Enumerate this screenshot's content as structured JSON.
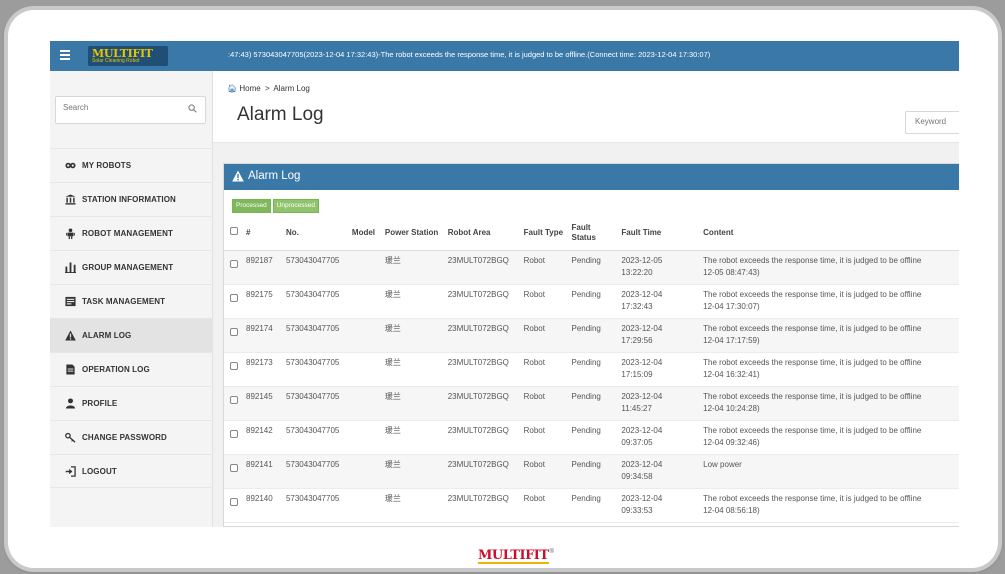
{
  "brand": {
    "logo_text": "MULTIFIT",
    "logo_subtitle": "Solar Cleaning Robot",
    "footer_logo": "MULTIFIT",
    "footer_reg": "®"
  },
  "topbar": {
    "ticker": ":47:43)    573043047705(2023-12-04 17:32:43)-The robot exceeds the response time, it is judged to be offline.(Connect time:  2023-12-04 17:30:07)"
  },
  "sidebar": {
    "search_placeholder": "Search",
    "items": [
      {
        "label": "MY ROBOTS",
        "icon": "robots-icon"
      },
      {
        "label": "STATION INFORMATION",
        "icon": "station-icon"
      },
      {
        "label": "ROBOT MANAGEMENT",
        "icon": "robot-management-icon"
      },
      {
        "label": "GROUP MANAGEMENT",
        "icon": "group-icon"
      },
      {
        "label": "TASK MANAGEMENT",
        "icon": "task-icon"
      },
      {
        "label": "ALARM LOG",
        "icon": "warning-icon",
        "active": true
      },
      {
        "label": "OPERATION LOG",
        "icon": "document-icon"
      },
      {
        "label": "PROFILE",
        "icon": "user-icon"
      },
      {
        "label": "CHANGE PASSWORD",
        "icon": "key-icon"
      },
      {
        "label": "LOGOUT",
        "icon": "logout-icon"
      }
    ]
  },
  "breadcrumb": {
    "home": "Home",
    "separator": ">",
    "current": "Alarm Log"
  },
  "page": {
    "title": "Alarm Log",
    "keyword_placeholder": "Keyword"
  },
  "panel": {
    "title": "Alarm Log",
    "filters": [
      "Processed",
      "Unprocessed"
    ]
  },
  "table": {
    "headers": {
      "id": "#",
      "no": "No.",
      "model": "Model",
      "power_station": "Power Station",
      "robot_area": "Robot Area",
      "fault_type": "Fault Type",
      "fault_status": "Fault Status",
      "fault_time": "Fault Time",
      "content": "Content"
    },
    "rows": [
      {
        "id": "892187",
        "no": "573043047705",
        "model": "",
        "station": "瑗兰",
        "area": "23MULT072BGQ",
        "type": "Robot",
        "status": "Pending",
        "date": "2023-12-05",
        "time": "13:22:20",
        "c1": "The robot exceeds the response time, it is judged to be offline",
        "c2": "12-05 08:47:43)"
      },
      {
        "id": "892175",
        "no": "573043047705",
        "model": "",
        "station": "瑗兰",
        "area": "23MULT072BGQ",
        "type": "Robot",
        "status": "Pending",
        "date": "2023-12-04",
        "time": "17:32:43",
        "c1": "The robot exceeds the response time, it is judged to be offline",
        "c2": "12-04 17:30:07)"
      },
      {
        "id": "892174",
        "no": "573043047705",
        "model": "",
        "station": "瑗兰",
        "area": "23MULT072BGQ",
        "type": "Robot",
        "status": "Pending",
        "date": "2023-12-04",
        "time": "17:29:56",
        "c1": "The robot exceeds the response time, it is judged to be offline",
        "c2": "12-04 17:17:59)"
      },
      {
        "id": "892173",
        "no": "573043047705",
        "model": "",
        "station": "瑗兰",
        "area": "23MULT072BGQ",
        "type": "Robot",
        "status": "Pending",
        "date": "2023-12-04",
        "time": "17:15:09",
        "c1": "The robot exceeds the response time, it is judged to be offline",
        "c2": "12-04 16:32:41)"
      },
      {
        "id": "892145",
        "no": "573043047705",
        "model": "",
        "station": "瑗兰",
        "area": "23MULT072BGQ",
        "type": "Robot",
        "status": "Pending",
        "date": "2023-12-04",
        "time": "11:45:27",
        "c1": "The robot exceeds the response time, it is judged to be offline",
        "c2": "12-04 10:24:28)"
      },
      {
        "id": "892142",
        "no": "573043047705",
        "model": "",
        "station": "瑗兰",
        "area": "23MULT072BGQ",
        "type": "Robot",
        "status": "Pending",
        "date": "2023-12-04",
        "time": "09:37:05",
        "c1": "The robot exceeds the response time, it is judged to be offline",
        "c2": "12-04 09:32:46)"
      },
      {
        "id": "892141",
        "no": "573043047705",
        "model": "",
        "station": "瑗兰",
        "area": "23MULT072BGQ",
        "type": "Robot",
        "status": "Pending",
        "date": "2023-12-04",
        "time": "09:34:58",
        "c1": "Low power",
        "c2": ""
      },
      {
        "id": "892140",
        "no": "573043047705",
        "model": "",
        "station": "瑗兰",
        "area": "23MULT072BGQ",
        "type": "Robot",
        "status": "Pending",
        "date": "2023-12-04",
        "time": "09:33:53",
        "c1": "The robot exceeds the response time, it is judged to be offline",
        "c2": "12-04 08:56:18)"
      }
    ]
  },
  "colors": {
    "topbar": "#3a78a8",
    "panel_header": "#3a78a8",
    "filter_button": "#8fc46b",
    "frame": "#9c9c9c"
  }
}
